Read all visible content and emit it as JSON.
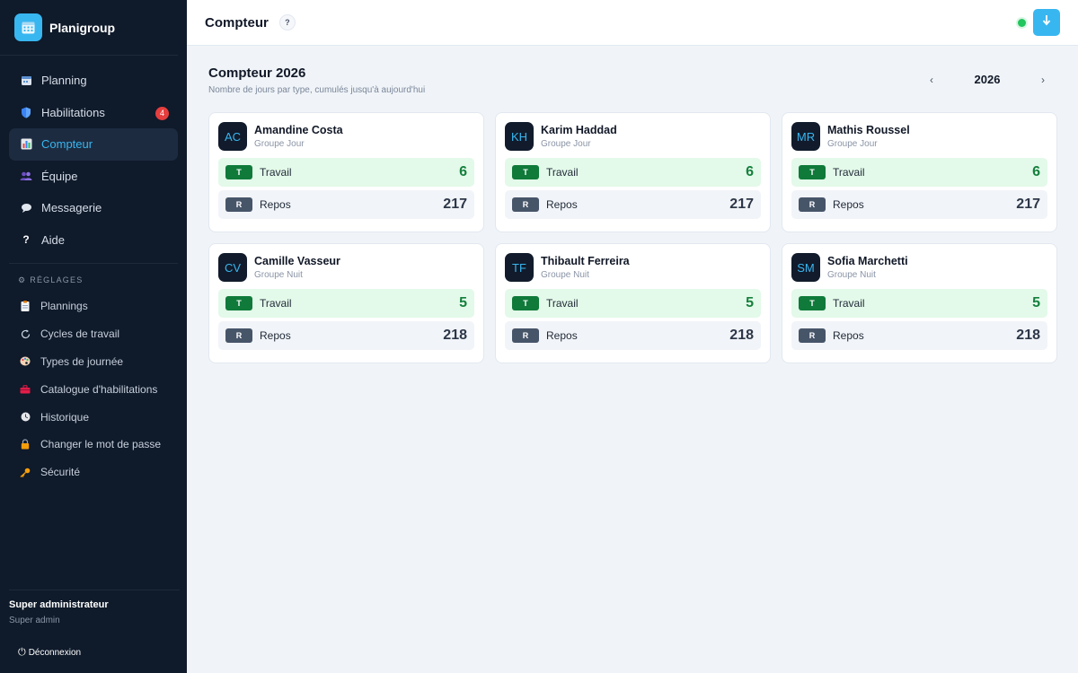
{
  "app": {
    "name": "Planigroup",
    "accent": "#38b6f0"
  },
  "nav": [
    {
      "label": "Planning",
      "icon": "calendar-icon"
    },
    {
      "label": "Habilitations",
      "icon": "shield-icon",
      "badge": "4"
    },
    {
      "label": "Compteur",
      "icon": "bar-chart-icon",
      "active": true
    },
    {
      "label": "Équipe",
      "icon": "team-icon"
    },
    {
      "label": "Messagerie",
      "icon": "chat-bubble-icon"
    },
    {
      "label": "Aide",
      "icon": "question-icon"
    }
  ],
  "settings": {
    "title": "RÉGLAGES",
    "items": [
      {
        "label": "Plannings",
        "icon": "clipboard-icon"
      },
      {
        "label": "Cycles de travail",
        "icon": "refresh-icon"
      },
      {
        "label": "Types de journée",
        "icon": "palette-icon"
      },
      {
        "label": "Catalogue d'habilitations",
        "icon": "toolbox-icon"
      },
      {
        "label": "Historique",
        "icon": "clock-icon"
      },
      {
        "label": "Changer le mot de passe",
        "icon": "lock-icon"
      },
      {
        "label": "Sécurité",
        "icon": "key-icon"
      }
    ]
  },
  "user": {
    "name": "Super administrateur",
    "role": "Super admin",
    "logout": "Déconnexion"
  },
  "topbar": {
    "title": "Compteur",
    "help": "?"
  },
  "page": {
    "title": "Compteur 2026",
    "subtitle": "Nombre de jours par type, cumulés jusqu'à aujourd'hui",
    "year": "2026",
    "prev": "‹",
    "next": "›"
  },
  "cards": [
    {
      "initials": "AC",
      "name": "Amandine Costa",
      "group": "Groupe Jour",
      "work_tag": "T",
      "work_label": "Travail",
      "work_value": "6",
      "rest_tag": "R",
      "rest_label": "Repos",
      "rest_value": "217"
    },
    {
      "initials": "KH",
      "name": "Karim Haddad",
      "group": "Groupe Jour",
      "work_tag": "T",
      "work_label": "Travail",
      "work_value": "6",
      "rest_tag": "R",
      "rest_label": "Repos",
      "rest_value": "217"
    },
    {
      "initials": "MR",
      "name": "Mathis Roussel",
      "group": "Groupe Jour",
      "work_tag": "T",
      "work_label": "Travail",
      "work_value": "6",
      "rest_tag": "R",
      "rest_label": "Repos",
      "rest_value": "217"
    },
    {
      "initials": "CV",
      "name": "Camille Vasseur",
      "group": "Groupe Nuit",
      "work_tag": "T",
      "work_label": "Travail",
      "work_value": "5",
      "rest_tag": "R",
      "rest_label": "Repos",
      "rest_value": "218"
    },
    {
      "initials": "TF",
      "name": "Thibault Ferreira",
      "group": "Groupe Nuit",
      "work_tag": "T",
      "work_label": "Travail",
      "work_value": "5",
      "rest_tag": "R",
      "rest_label": "Repos",
      "rest_value": "218"
    },
    {
      "initials": "SM",
      "name": "Sofia Marchetti",
      "group": "Groupe Nuit",
      "work_tag": "T",
      "work_label": "Travail",
      "work_value": "5",
      "rest_tag": "R",
      "rest_label": "Repos",
      "rest_value": "218"
    }
  ]
}
